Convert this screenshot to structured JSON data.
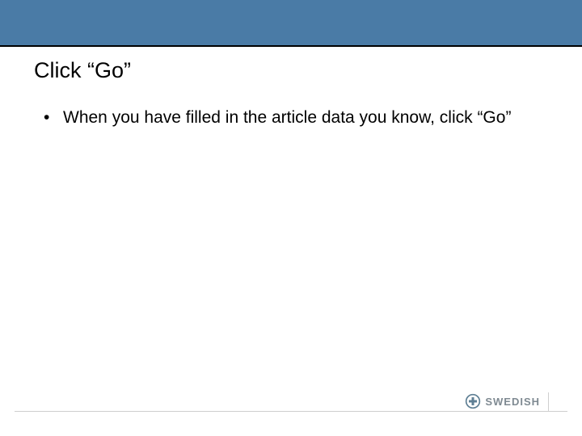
{
  "header": {
    "accent_color": "#4a7ba6"
  },
  "slide": {
    "title": "Click “Go”",
    "bullets": [
      {
        "text": "When you have filled in the article data you know, click “Go”"
      }
    ]
  },
  "footer": {
    "logo_text": "SWEDISH",
    "logo_icon": "plus-circle-icon"
  }
}
